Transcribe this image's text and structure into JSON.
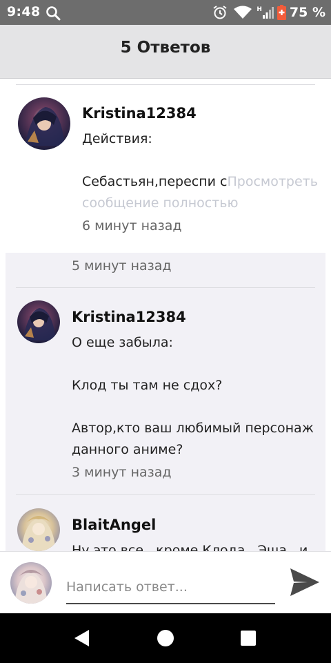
{
  "status_bar": {
    "time": "9:48",
    "battery_percent": "75 %",
    "network_label": "H",
    "icons": [
      "search-icon",
      "alarm-icon",
      "wifi-icon",
      "signal-icon",
      "battery-icon"
    ]
  },
  "header": {
    "title": "5 Ответов"
  },
  "comments": [
    {
      "username": "Kristina12384",
      "message": "Действия:\n\nСебастьян,переспи с",
      "more_text": "Просмотреть сообщение полностью",
      "time": "6 минут назад"
    },
    {
      "time": "5 минут назад"
    },
    {
      "username": "Kristina12384",
      "message": "О еще забыла:\n\nКлод ты там не сдох?\n\nАвтор,кто ваш любимый персонаж данного аниме?",
      "time": "3 минут назад"
    },
    {
      "username": "BlaitAngel",
      "message": "Ну это все , кроме Клода , Эша , и"
    }
  ],
  "reply": {
    "placeholder": "Написать ответ..."
  },
  "colors": {
    "status_bar": "#6d6d6d",
    "header": "#e4e4e6",
    "thread_bg": "#f2f1f6",
    "battery": "#f25c3a",
    "send": "#4a4a4a"
  }
}
